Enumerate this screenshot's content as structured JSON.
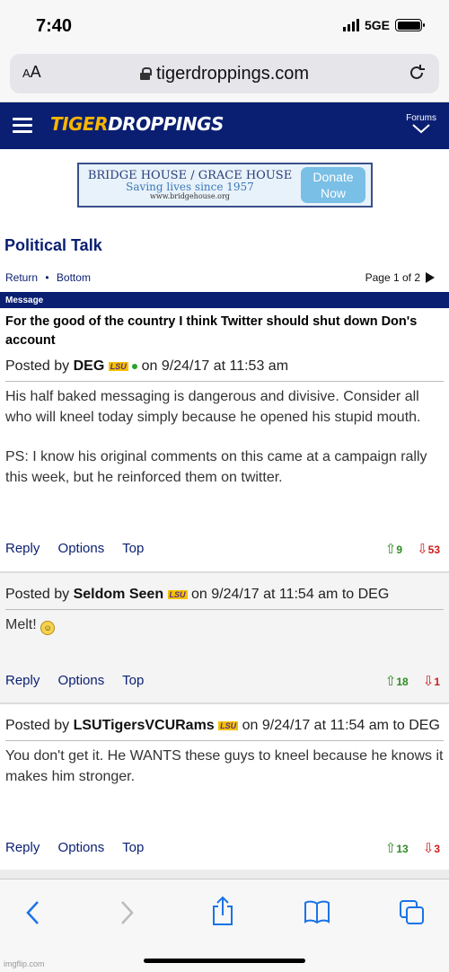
{
  "status_bar": {
    "time": "7:40",
    "network": "5GE"
  },
  "browser": {
    "text_size_label_small": "A",
    "text_size_label_large": "A",
    "url": "tigerdroppings.com"
  },
  "site": {
    "logo_part1": "TIGER",
    "logo_part2": "DROPPINGS",
    "forums_label": "Forums"
  },
  "ad": {
    "line1": "BRIDGE HOUSE / GRACE HOUSE",
    "line2": "Saving lives since 1957",
    "line3": "www.bridgehouse.org",
    "donate_label": "Donate Now"
  },
  "forum": {
    "title": "Political Talk",
    "return_label": "Return",
    "bullet": "•",
    "bottom_label": "Bottom",
    "page_label": "Page 1 of 2",
    "message_header": "Message"
  },
  "posts": [
    {
      "subject": "For the good of the country I think Twitter should shut down Don's account",
      "posted_prefix": "Posted by",
      "author": "DEG",
      "badge": "LSU",
      "timestamp_text": "on 9/24/17 at 11:53 am",
      "body_p1": "His half baked messaging is dangerous and divisive. Consider all who will kneel today simply because he opened his stupid mouth.",
      "body_p2": "PS: I know his original comments on this came at a campaign rally this week, but he reinforced them on twitter.",
      "reply_label": "Reply",
      "options_label": "Options",
      "top_label": "Top",
      "upvotes": "9",
      "downvotes": "53"
    },
    {
      "posted_prefix": "Posted by",
      "author": "Seldom Seen",
      "badge": "LSU",
      "timestamp_text": "on 9/24/17 at 11:54 am to DEG",
      "body": "Melt!",
      "emoji_icon": "laughing-emoji",
      "reply_label": "Reply",
      "options_label": "Options",
      "top_label": "Top",
      "upvotes": "18",
      "downvotes": "1"
    },
    {
      "posted_prefix": "Posted by",
      "author": "LSUTigersVCURams",
      "badge": "LSU",
      "timestamp_text": "on 9/24/17 at 11:54 am to DEG",
      "body": "You don't get it. He WANTS these guys to kneel because he knows it makes him stronger.",
      "reply_label": "Reply",
      "options_label": "Options",
      "top_label": "Top",
      "upvotes": "13",
      "downvotes": "3"
    }
  ],
  "toolbar_icons": [
    "back-icon",
    "forward-icon",
    "share-icon",
    "bookmarks-icon",
    "tabs-icon"
  ],
  "watermark": "imgflip.com",
  "colors": {
    "navy": "#0a1f72",
    "gold": "#f7b500",
    "upvote": "#2e8b22",
    "downvote": "#cc1a1a"
  }
}
